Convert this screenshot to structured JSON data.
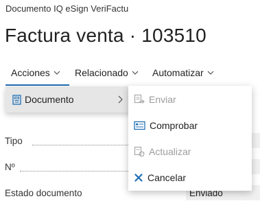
{
  "breadcrumb": "Documento IQ eSign VeriFactu",
  "title": "Factura venta · 103510",
  "actions": [
    {
      "label": "Acciones"
    },
    {
      "label": "Relacionado"
    },
    {
      "label": "Automatizar"
    }
  ],
  "fields": [
    {
      "label": "Tipo",
      "value": ""
    },
    {
      "label": "Nº",
      "value": ""
    },
    {
      "label": "Estado documento",
      "value": "Enviado"
    }
  ],
  "menu_level1": {
    "label": "Documento"
  },
  "menu_level2": [
    {
      "label": "Enviar",
      "icon": "send-document-icon",
      "disabled": true
    },
    {
      "label": "Comprobar",
      "icon": "check-card-icon",
      "disabled": false
    },
    {
      "label": "Actualizar",
      "icon": "update-document-icon",
      "disabled": true
    },
    {
      "label": "Cancelar",
      "icon": "cancel-x-icon",
      "disabled": false
    }
  ],
  "colors": {
    "accent": "#1f6fb5",
    "highlight": "#e6e6e6",
    "disabled": "#9c9c9c"
  }
}
